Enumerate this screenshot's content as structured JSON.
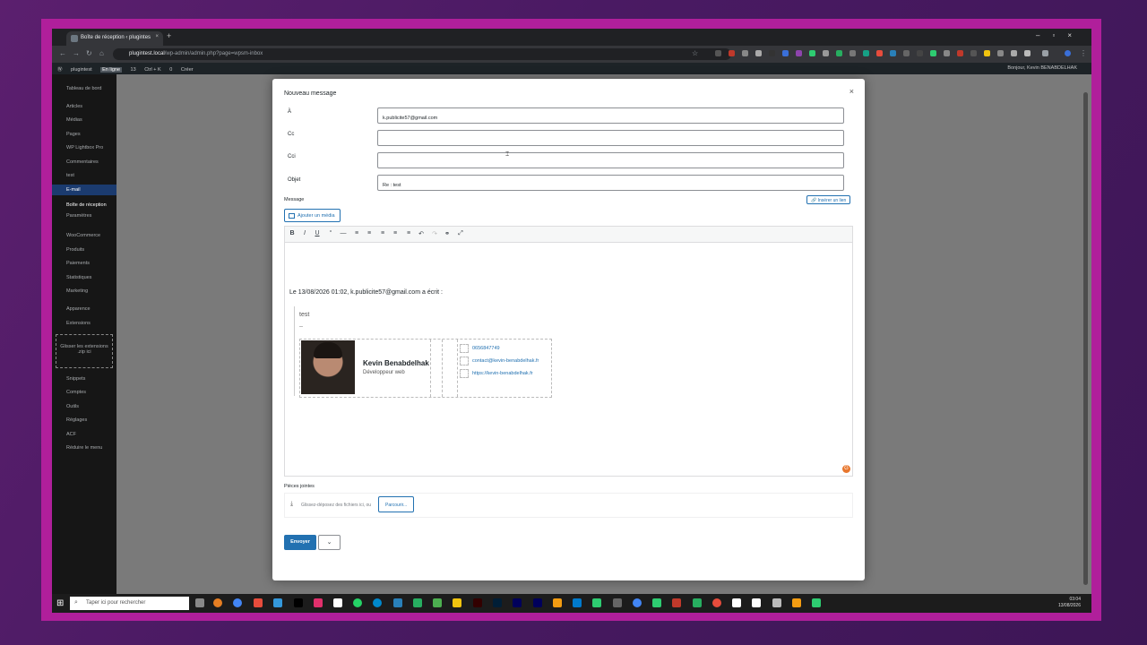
{
  "browser": {
    "tab_title": "Boîte de réception ‹ plugintes",
    "url_host": "plugintest.local",
    "url_path": "/wp-admin/admin.php?page=wpsm-inbox"
  },
  "wp_bar": {
    "site": "plugintest",
    "badge": "En ligne",
    "updates": "13",
    "shortcut": "Ctrl + K",
    "comments": "0",
    "create": "Créer",
    "greeting": "Bonjour, Kevin BENABDELHAK"
  },
  "sidebar": [
    "Tableau de bord",
    "Articles",
    "Médias",
    "Pages",
    "WP Lightbox Pro",
    "Commentaires",
    "test",
    "E-mail",
    "Boîte de réception",
    "Paramètres",
    "WooCommerce",
    "Produits",
    "Paiements",
    "Statistiques",
    "Marketing",
    "Apparence",
    "Extensions",
    "Glisser les extensions .zip ici",
    "Snippets",
    "Comptes",
    "Outils",
    "Réglages",
    "ACF",
    "Réduire le menu"
  ],
  "modal": {
    "title": "Nouveau message",
    "close": "×",
    "to_label": "À",
    "to_value": "k.publicite57@gmail.com",
    "cc_label": "Cc",
    "bcc_label": "Cci",
    "subject_label": "Objet",
    "subject_value": "Re : test",
    "message_label": "Message",
    "insert_link": "Insérer un lien",
    "add_media": "Ajouter un média",
    "quote_intro": "Le 13/08/2026 01:02, k.publicite57@gmail.com a écrit :",
    "quoted_text": "test",
    "quoted_dash": "--",
    "signature": {
      "name": "Kevin Benabdelhak",
      "role": "Développeur web",
      "phone": "0656847749",
      "email": "contact@kevin-benabdelhak.fr",
      "website": "https://kevin-benabdelhak.fr"
    },
    "attachments_label": "Pièces jointes",
    "dropzone_text": "Glissez-déposez des fichiers ici, ou",
    "browse": "Parcourir...",
    "send": "Envoyer"
  },
  "taskbar": {
    "search_placeholder": "Taper ici pour rechercher",
    "time": "03:04",
    "date": "13/08/2026"
  }
}
